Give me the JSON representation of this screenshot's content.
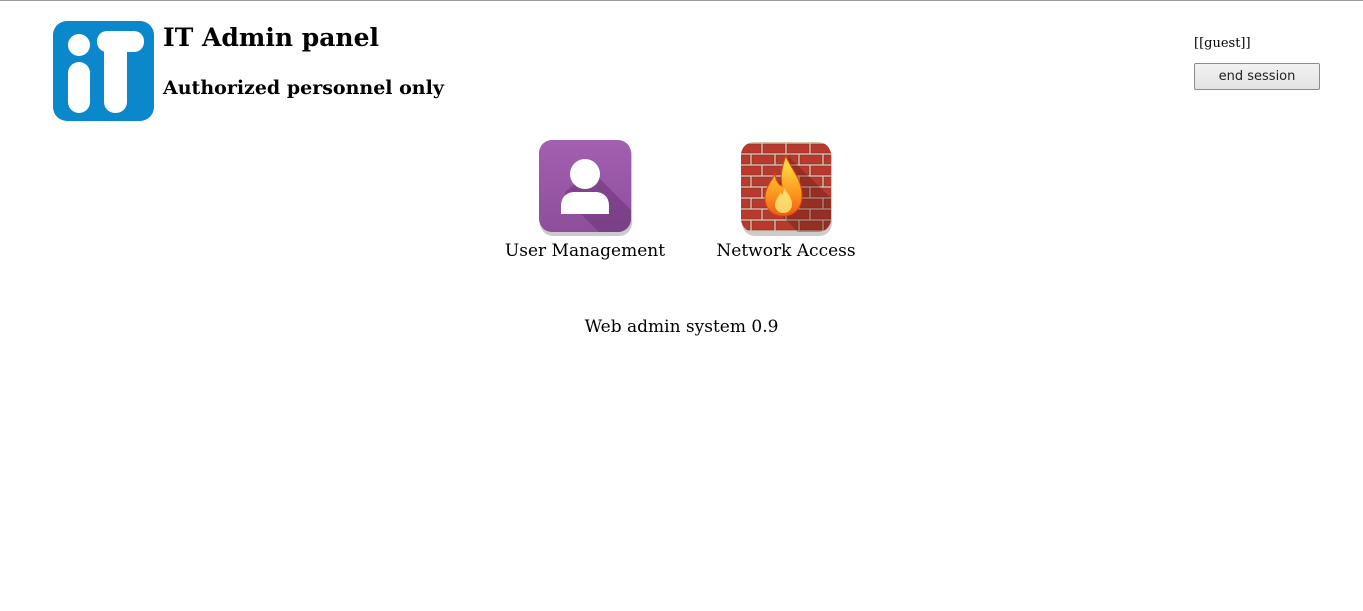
{
  "header": {
    "title": "IT Admin panel",
    "subtitle": "Authorized personnel only",
    "logo_text": "iT",
    "logo_color": "#0b88cc"
  },
  "session": {
    "user_label": "[[guest]]",
    "end_label": "end session"
  },
  "apps": [
    {
      "label": "User Management",
      "icon": "user-icon",
      "color": "#9b59a8"
    },
    {
      "label": "Network Access",
      "icon": "firewall-icon",
      "color": "#b5362e"
    }
  ],
  "footer": {
    "text": "Web admin system 0.9"
  }
}
